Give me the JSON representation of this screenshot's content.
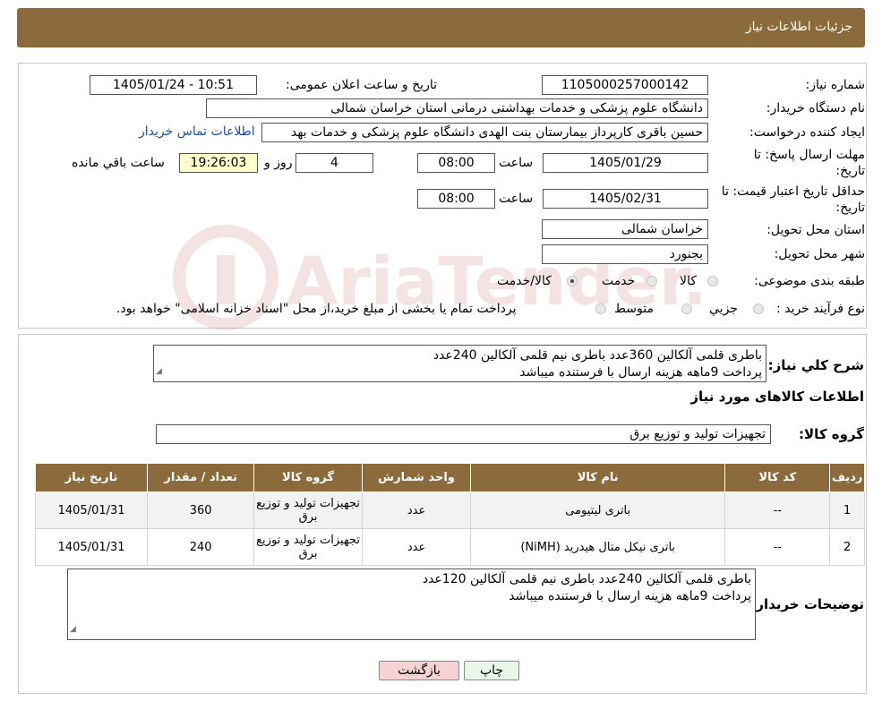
{
  "page_title": "جزئیات اطلاعات نیاز",
  "fields": {
    "need_number_label": "شماره نیاز:",
    "need_number": "1105000257000142",
    "announce_label": "تاریخ و ساعت اعلان عمومی:",
    "announce_value": "1405/01/24 - 10:51",
    "buyer_org_label": "نام دستگاه خریدار:",
    "buyer_org": "دانشگاه علوم پزشکی و خدمات بهداشتی درمانی استان خراسان شمالی",
    "requester_label": "ایجاد کننده درخواست:",
    "requester": "حسین باقری کارپرداز بیمارستان بنت الهدی دانشگاه علوم پزشکی و خدمات بهد",
    "contact_link": "اطلاعات تماس خریدار",
    "reply_deadline_label_1": "مهلت ارسال پاسخ: تا",
    "reply_deadline_label_2": "تاریخ:",
    "reply_date": "1405/01/29",
    "time_label": "ساعت",
    "reply_time": "08:00",
    "days_value": "4",
    "days_label": "روز و",
    "remaining_time": "19:26:03",
    "remaining_label": "ساعت باقي مانده",
    "price_validity_label_1": "حداقل تاریخ اعتبار قیمت: تا",
    "price_validity_label_2": "تاریخ:",
    "price_validity_date": "1405/02/31",
    "price_validity_time": "08:00",
    "province_label": "استان محل تحویل:",
    "province": "خراسان شمالی",
    "city_label": "شهر محل تحویل:",
    "city": "بجنورد",
    "category_label": "طبقه بندی موضوعی:",
    "category_options": [
      "کالا",
      "خدمت",
      "کالا/خدمت"
    ],
    "process_label": "نوع فرآیند خرید :",
    "process_options": [
      "جزیي",
      "متوسط"
    ],
    "process_note": "پرداخت تمام یا بخشی از مبلغ خرید،از محل \"اسناد خزانه اسلامی\" خواهد بود."
  },
  "description": {
    "label": "شرح کلي نیاز:",
    "line1": "باطری قلمی آلکالین 360عدد باطری نیم قلمی آلکالین 240عدد",
    "line2": "پرداخت 9ماهه هزینه ارسال با فرستنده میباشد"
  },
  "goods_section_title": "اطلاعات کالاهای مورد نیاز",
  "goods_group_label": "گروه کالا:",
  "goods_group": "تجهیزات تولید و توزیع برق",
  "table": {
    "headers": [
      "ردیف",
      "کد کالا",
      "نام کالا",
      "واحد شمارش",
      "گروه کالا",
      "تعداد / مقدار",
      "تاریخ نیاز"
    ],
    "rows": [
      [
        "1",
        "--",
        "باتری لیتیومی",
        "عدد",
        "تجهیزات تولید و توزیع برق",
        "360",
        "1405/01/31"
      ],
      [
        "2",
        "--",
        "باتری نیکل متال هیدرید (NiMH)",
        "عدد",
        "تجهیزات تولید و توزیع برق",
        "240",
        "1405/01/31"
      ]
    ]
  },
  "buyer_notes": {
    "label": "توضیحات خریدار:",
    "line1": "باطری قلمی آلکالین 240عدد باطری نیم قلمی آلکالین 120عدد",
    "line2": "پرداخت 9ماهه هزینه ارسال با فرستنده میباشد"
  },
  "buttons": {
    "print": "چاپ",
    "back": "بازگشت"
  },
  "watermark_text": "AriaTender.neT",
  "colors": {
    "header_brown": "#8b6a3c",
    "back_button": "#f6d3d3",
    "print_button": "#e9f7e9",
    "link": "#1d4fa3"
  }
}
